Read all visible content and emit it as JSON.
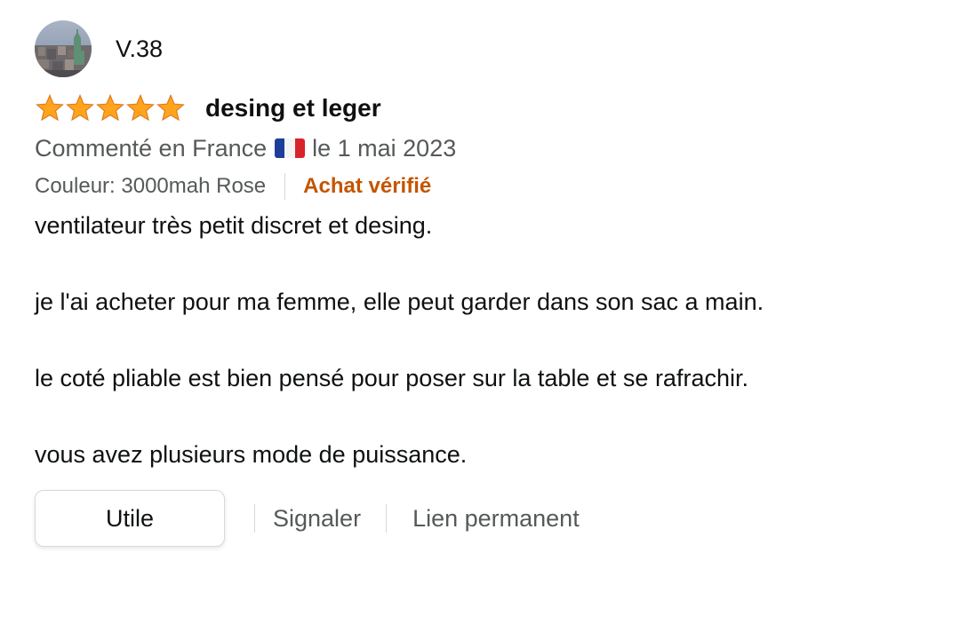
{
  "reviewer": {
    "name": "V.38",
    "avatar_icon": "avatar-photo-icon"
  },
  "rating": {
    "stars": 5,
    "max": 5,
    "color": "#ffa41c"
  },
  "review": {
    "title": "desing et leger",
    "meta_prefix": "Commenté en France",
    "meta_suffix": "le 1 mai 2023",
    "flag_icon": "france-flag-icon",
    "variant": "Couleur: 3000mah Rose",
    "verified": "Achat vérifié",
    "verified_color": "#c45500",
    "paragraphs": [
      "ventilateur très petit discret et desing.",
      "je l'ai acheter pour ma femme, elle peut garder dans son sac a main.",
      "le coté pliable est bien pensé pour poser sur la table et se rafrachir.",
      "vous avez plusieurs mode de puissance."
    ]
  },
  "actions": {
    "helpful": "Utile",
    "report": "Signaler",
    "permalink": "Lien permanent"
  }
}
